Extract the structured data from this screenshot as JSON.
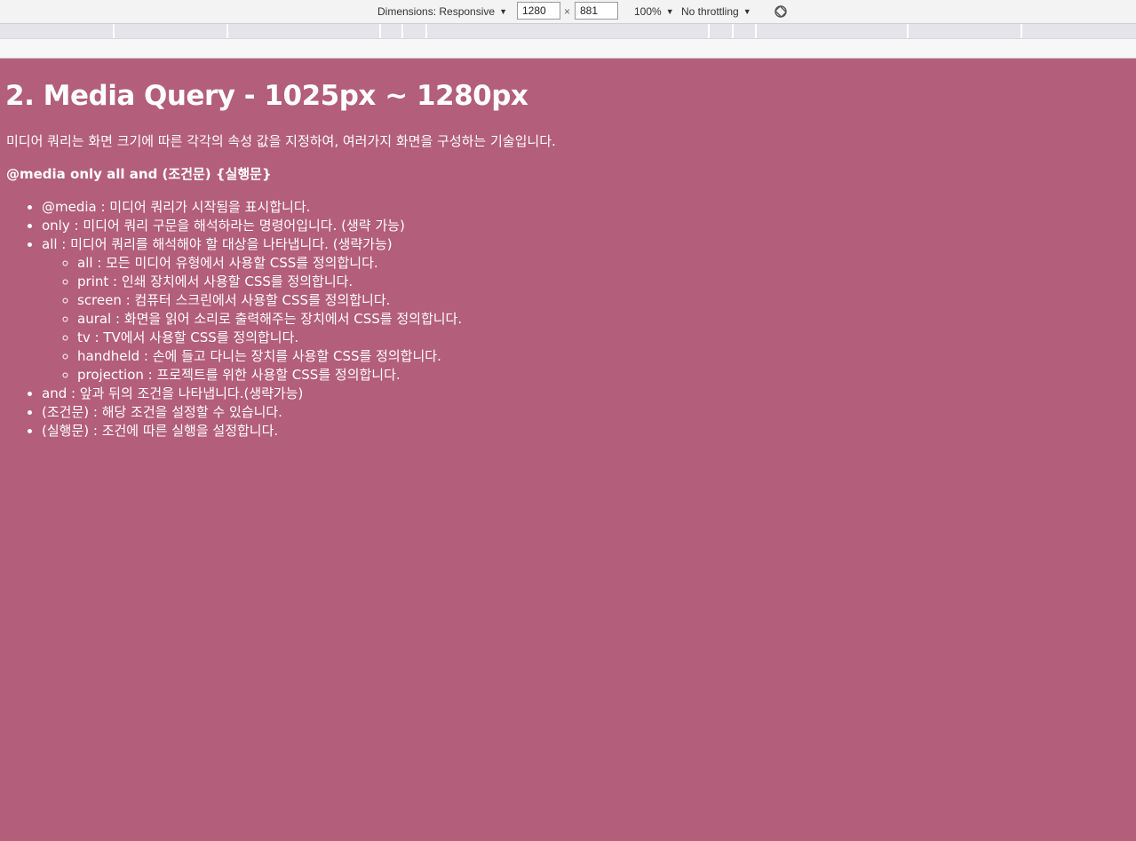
{
  "devtools": {
    "dimensions_label": "Dimensions: Responsive",
    "width_value": "1280",
    "times_symbol": "×",
    "height_value": "881",
    "zoom": "100%",
    "throttling": "No throttling",
    "caret": "▼"
  },
  "page": {
    "heading": "2. Media Query - 1025px ~ 1280px",
    "description": "미디어 쿼리는 화면 크기에 따른 각각의 속성 값을 지정하여, 여러가지 화면을 구성하는 기술입니다.",
    "syntax": "@media only all and (조건문) {실행문}",
    "items": [
      "@media : 미디어 쿼리가 시작됨을 표시합니다.",
      "only : 미디어 쿼리 구문을 해석하라는 명령어입니다. (생략 가능)",
      "all : 미디어 쿼리를 해석해야 할 대상을 나타냅니다. (생략가능)"
    ],
    "sub_items": [
      "all : 모든 미디어 유형에서 사용할 CSS를 정의합니다.",
      "print : 인쇄 장치에서 사용할 CSS를 정의합니다.",
      "screen : 컴퓨터 스크린에서 사용할 CSS를 정의합니다.",
      "aural : 화면을 읽어 소리로 출력해주는 장치에서 CSS를 정의합니다.",
      "tv : TV에서 사용할 CSS를 정의합니다.",
      "handheld : 손에 들고 다니는 장치를 사용할 CSS를 정의합니다.",
      "projection : 프로젝트를 위한 사용할 CSS를 정의합니다."
    ],
    "items_after": [
      "and : 앞과 뒤의 조건을 나타냅니다.(생략가능)",
      "(조건문) : 해당 조건을 설정할 수 있습니다.",
      "(실행문) : 조건에 따른 실행을 설정합니다."
    ]
  },
  "colors": {
    "page_background": "#b35e7a",
    "text": "#ffffff"
  }
}
